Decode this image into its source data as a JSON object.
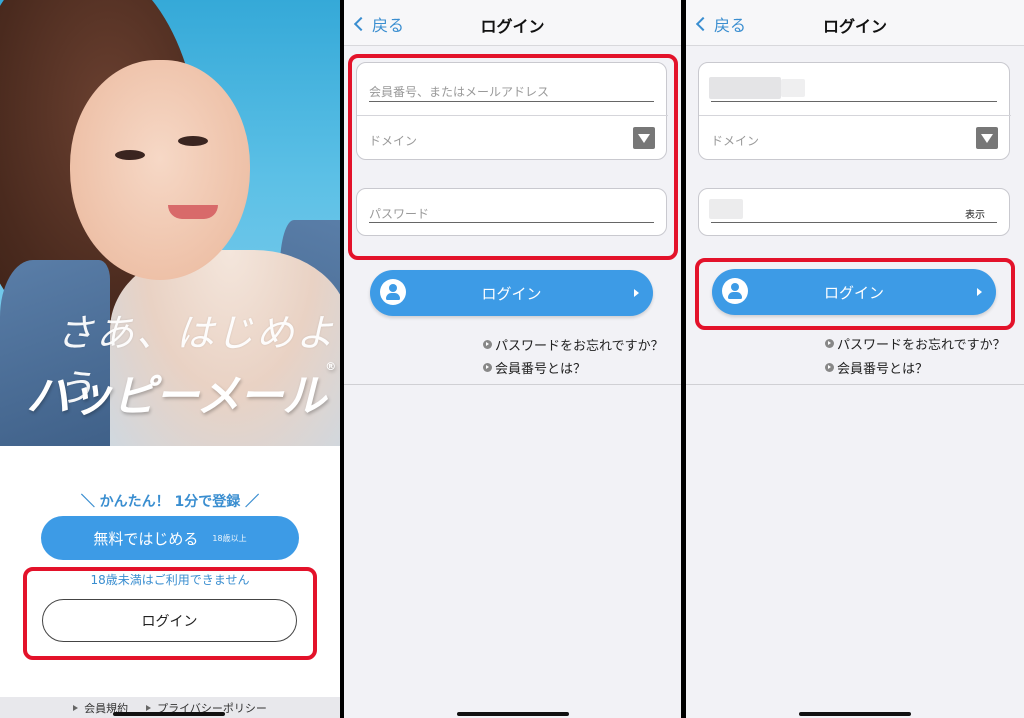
{
  "panel1": {
    "hero": {
      "tagline": "さあ、はじめよう",
      "brand": "ハッピーメール",
      "reg_mark": "®"
    },
    "catch": "＼ かんたん！ 1分で登録 ／",
    "start_button": {
      "label": "無料ではじめる",
      "age_note": "18歳以上"
    },
    "notice": "18歳未満はご利用できません",
    "login_button": "ログイン",
    "footer": {
      "terms": "会員規約",
      "privacy": "プライバシーポリシー"
    }
  },
  "panel2": {
    "nav": {
      "back": "戻る",
      "title": "ログイン"
    },
    "member_placeholder": "会員番号、またはメールアドレス",
    "domain_label": "ドメイン",
    "password_placeholder": "パスワード",
    "login_button": "ログイン",
    "links": {
      "forgot": "パスワードをお忘れですか？",
      "what_member": "会員番号とは？"
    }
  },
  "panel3": {
    "nav": {
      "back": "戻る",
      "title": "ログイン"
    },
    "domain_label": "ドメイン",
    "show_label": "表示",
    "login_button": "ログイン",
    "links": {
      "forgot": "パスワードをお忘れですか？",
      "what_member": "会員番号とは？"
    }
  },
  "colors": {
    "accent": "#3d9be6",
    "highlight": "#e3122a",
    "link_text": "#3a8ed0"
  }
}
